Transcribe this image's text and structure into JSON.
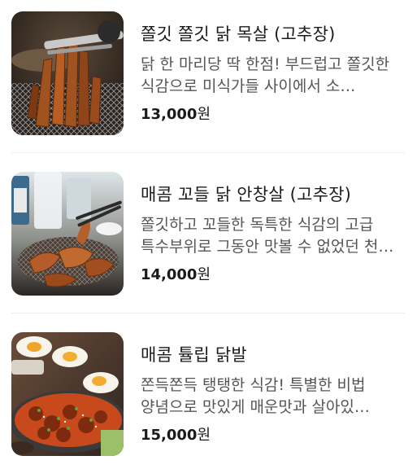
{
  "menu": {
    "items": [
      {
        "title": "쫄깃 쫄깃 닭 목살 (고추장)",
        "description": "닭 한 마리당 딱 한점! 부드럽고 쫄깃한 식감으로 미식가들 사이에서 소…",
        "price": "13,000",
        "currency": "원",
        "photo": "grilled-chicken-neck-photo"
      },
      {
        "title": "매콤 꼬들 닭 안창살 (고추장)",
        "description": "쫄깃하고 꼬들한 독특한 식감의 고급 특수부위로 그동안 맛볼 수 없었던 천상의 맛",
        "price": "14,000",
        "currency": "원",
        "photo": "grilled-chicken-skirt-photo"
      },
      {
        "title": "매콤 튤립 닭발",
        "description": "쫀득쫀득 탱탱한 식감! 특별한 비법 양념으로 맛있게 매운맛과 살아있…",
        "price": "15,000",
        "currency": "원",
        "photo": "spicy-chicken-feet-photo"
      }
    ]
  },
  "colors": {
    "title": "#1c1c1c",
    "description": "#555555",
    "price": "#1a1a1a",
    "divider": "#ececec"
  }
}
